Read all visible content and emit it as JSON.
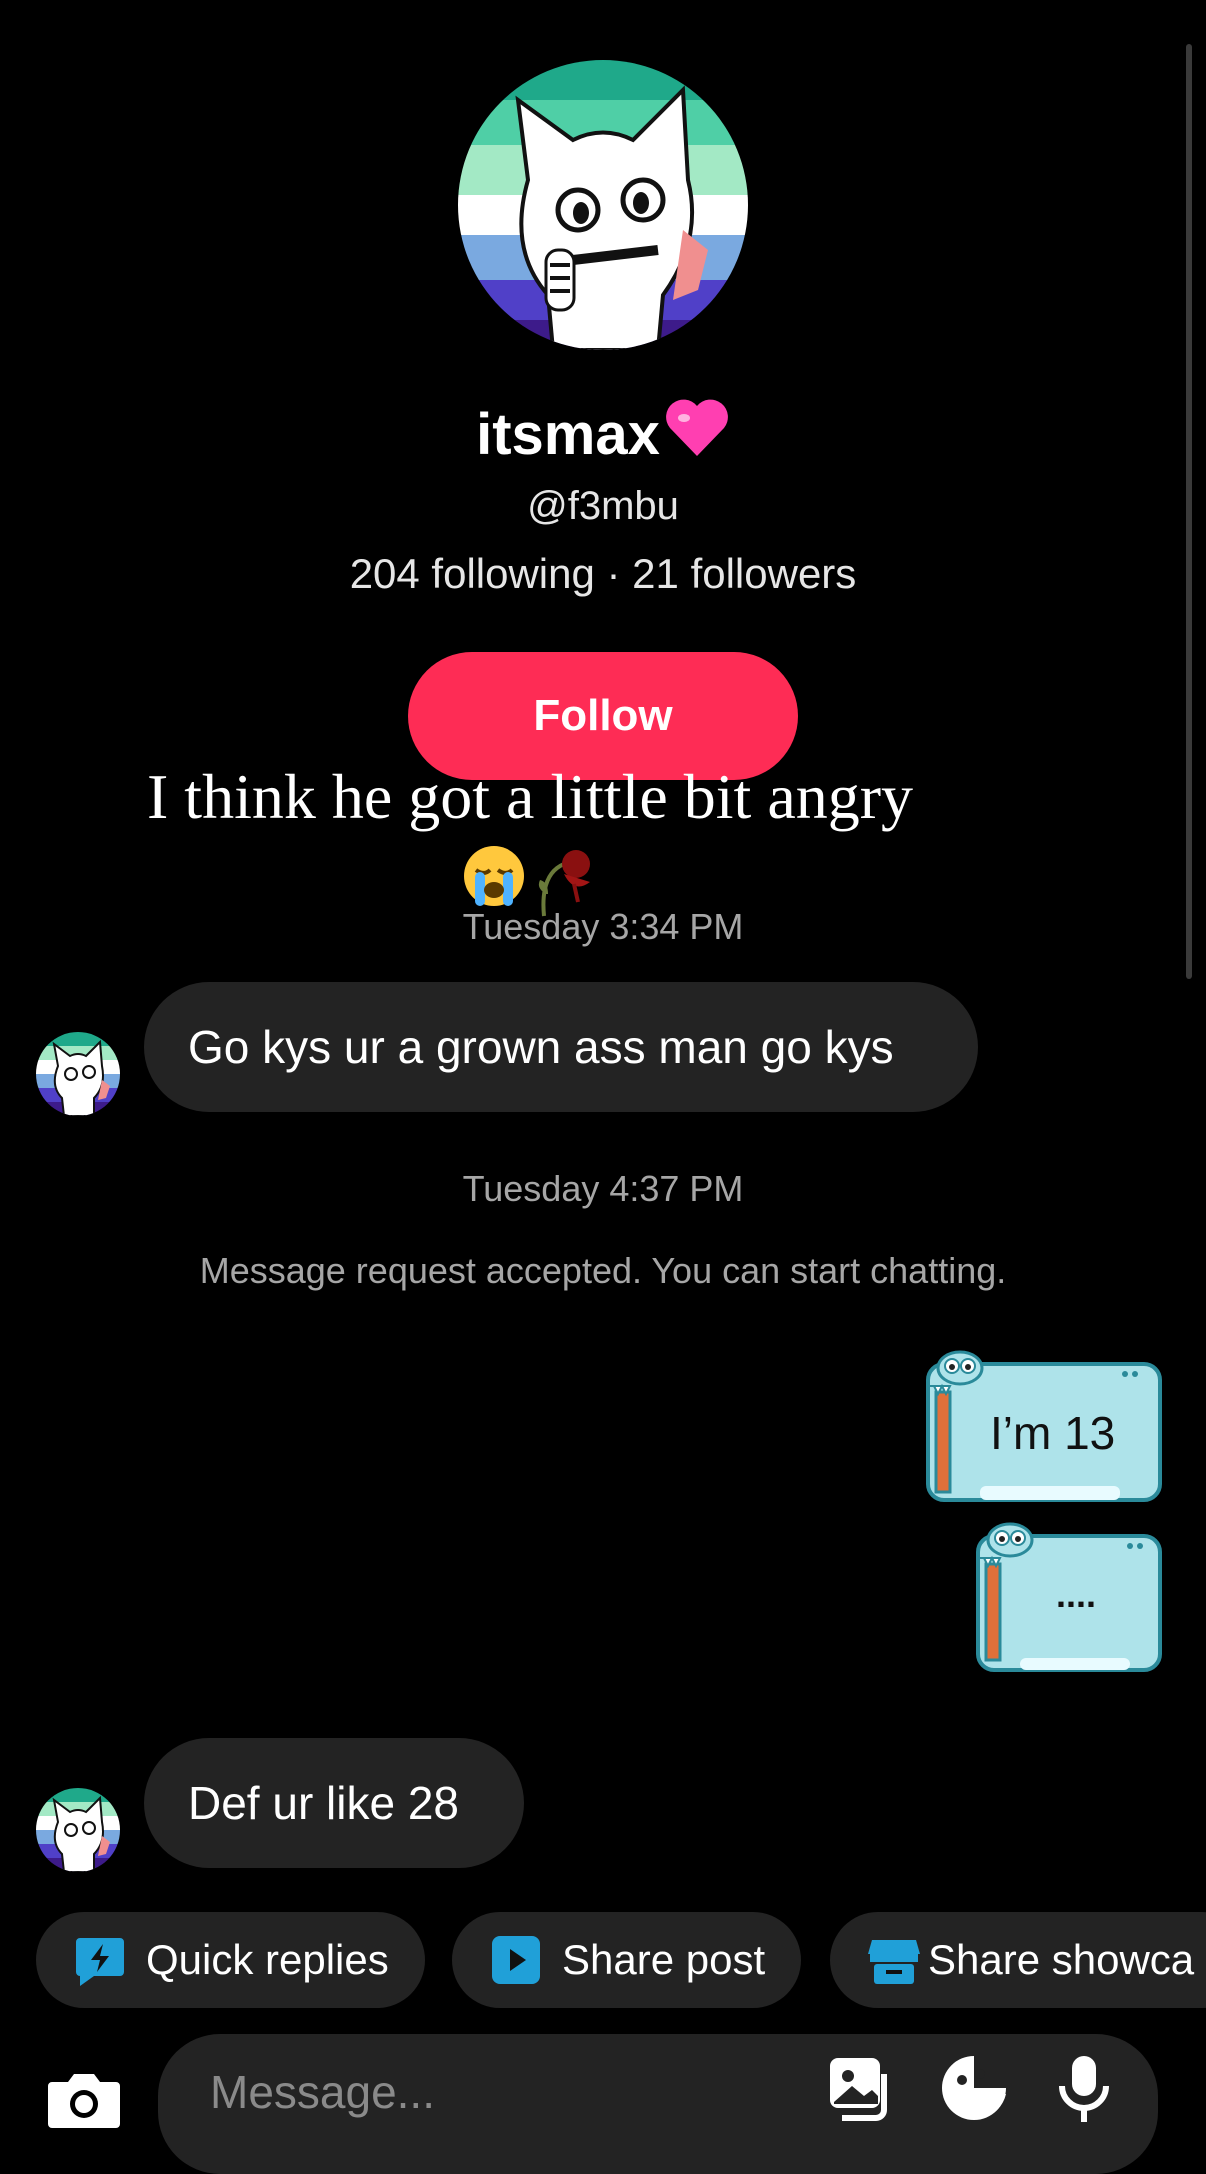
{
  "profile": {
    "display_name": "itsmax",
    "handle": "@f3mbu",
    "stats": "204 following · 21 followers",
    "follow_label": "Follow"
  },
  "overlay": {
    "caption": "I think he got a little bit angry",
    "emojis": [
      "crying-face-icon",
      "wilted-rose-icon"
    ]
  },
  "chat": {
    "timestamp_1": "Tuesday 3:34 PM",
    "msg_1": "Go kys ur a grown ass man go kys",
    "timestamp_2": "Tuesday 4:37 PM",
    "system_msg": "Message request accepted. You can start chatting.",
    "sticker_1_text": "I’m 13",
    "sticker_2_text": "....",
    "msg_2": "Def ur like 28"
  },
  "quick_actions": [
    {
      "label": "Quick replies",
      "icon": "lightning-icon"
    },
    {
      "label": "Share post",
      "icon": "play-icon"
    },
    {
      "label": "Share showca",
      "icon": "storefront-icon"
    }
  ],
  "composer": {
    "placeholder": "Message..."
  },
  "colors": {
    "accent": "#fe2c55",
    "bubble": "#232323",
    "chip_icon": "#20a0d8",
    "sticker": "#aee3ea"
  }
}
